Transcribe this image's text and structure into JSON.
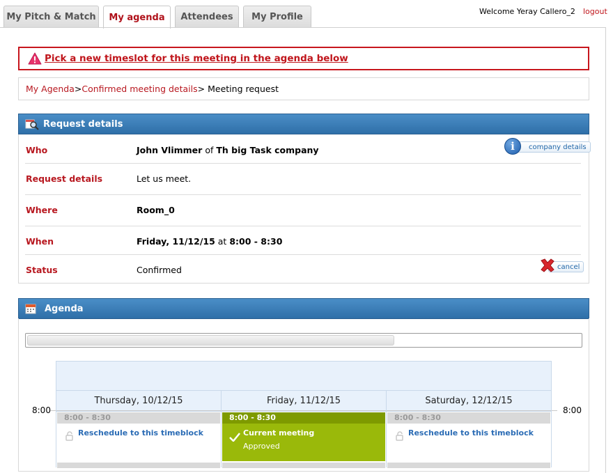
{
  "tabs": [
    {
      "label": "My Pitch & Match",
      "active": false
    },
    {
      "label": "My agenda",
      "active": true
    },
    {
      "label": "Attendees",
      "active": false
    },
    {
      "label": "My Profile",
      "active": false
    }
  ],
  "header": {
    "welcome": "Welcome Yeray Callero_2",
    "logout": "logout"
  },
  "alert": {
    "icon": "warning-icon",
    "text": "Pick a new timeslot for this meeting in the agenda below",
    "color": "#c7161d"
  },
  "breadcrumb": {
    "items": [
      "My Agenda",
      "Confirmed meeting details"
    ],
    "current": "Meeting request",
    "sep": ">"
  },
  "request_details": {
    "title": "Request details",
    "icon": "search-calendar-icon",
    "who": {
      "label": "Who",
      "person": "John Vlimmer",
      "of": "of",
      "company": "Th big Task company",
      "button": "company details"
    },
    "details": {
      "label": "Request details",
      "value": "Let us meet."
    },
    "where": {
      "label": "Where",
      "value": "Room_0"
    },
    "when": {
      "label": "When",
      "date": "Friday, 11/12/15",
      "at": "at",
      "time": "8:00 - 8:30"
    },
    "status": {
      "label": "Status",
      "value": "Confirmed",
      "button": "cancel"
    }
  },
  "agenda": {
    "title": "Agenda",
    "icon": "calendar-icon",
    "time_label": "8:00",
    "days": [
      {
        "label": "Thursday, 10/12/15",
        "slot": "8:00 - 8:30",
        "action": "Reschedule to this timeblock",
        "current": false
      },
      {
        "label": "Friday, 11/12/15",
        "slot": "8:00 - 8:30",
        "title": "Current meeting",
        "status": "Approved",
        "current": true
      },
      {
        "label": "Saturday, 12/12/15",
        "slot": "8:00 - 8:30",
        "action": "Reschedule to this timeblock",
        "current": false
      }
    ]
  },
  "colors": {
    "brand_red": "#b81820",
    "header_blue": "#2f6fa8",
    "current_green": "#9ab90a",
    "link_blue": "#2b6cb5"
  }
}
